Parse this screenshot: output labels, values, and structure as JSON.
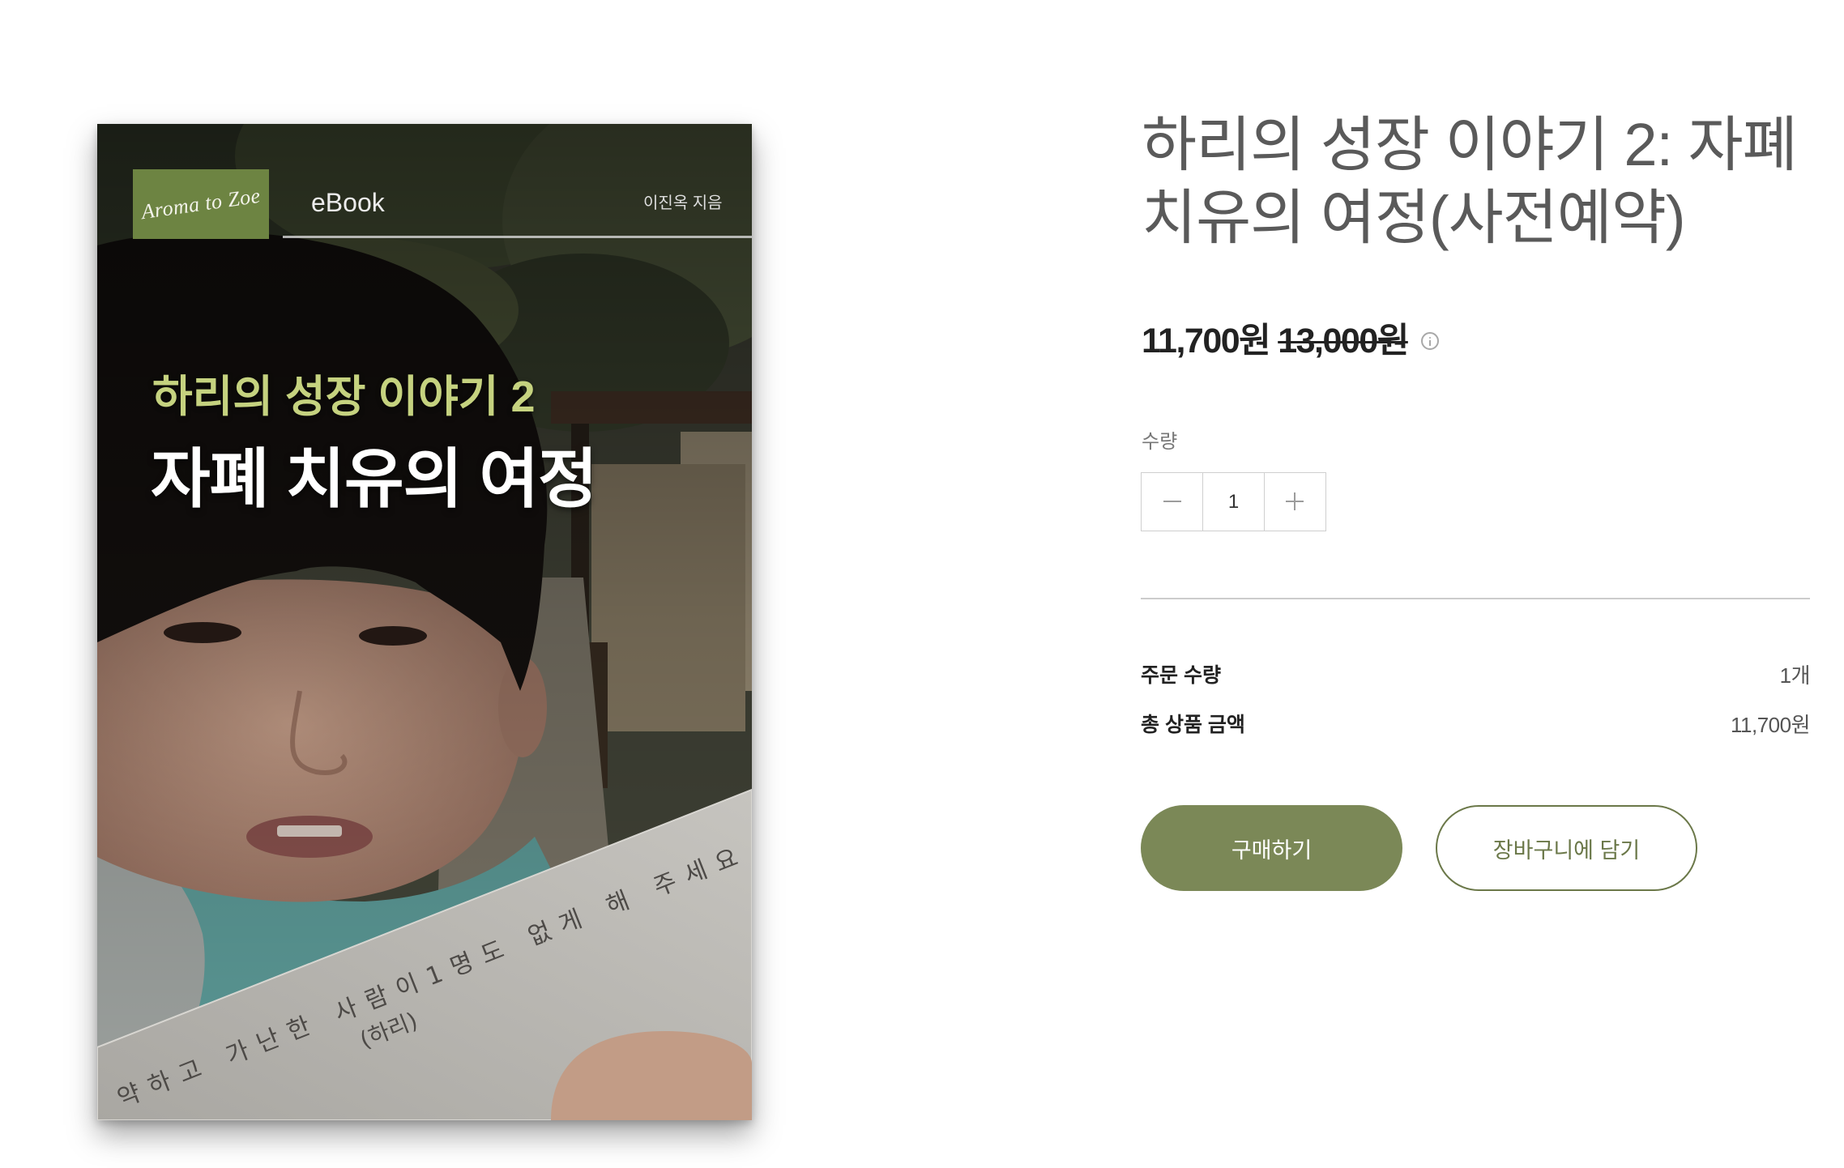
{
  "cover": {
    "logo_text": "Aroma to Zoe",
    "format_label": "eBook",
    "author": "이진옥 지음",
    "series_title": "하리의 성장 이야기 2",
    "main_title": "자폐 치유의 여정",
    "note_line1": "약하고 가난한 사람이1명도 없게 해 주세요",
    "note_line2": "(하리)"
  },
  "product": {
    "title": "하리의 성장 이야기 2: 자폐 치유의 여정(사전예약)",
    "sale_price": "11,700원",
    "original_price": "13,000원",
    "quantity_label": "수량",
    "quantity_value": "1"
  },
  "summary": {
    "order_quantity_label": "주문 수량",
    "order_quantity_value": "1개",
    "total_label": "총 상품 금액",
    "total_value": "11,700원"
  },
  "actions": {
    "buy_label": "구매하기",
    "cart_label": "장바구니에 담기"
  },
  "icons": {
    "price_info": "info-icon",
    "decrease": "minus-icon",
    "increase": "plus-icon"
  },
  "colors": {
    "accent": "#7b8857",
    "accent_outline": "#6b7849",
    "title_gray": "#5a5a5a",
    "logo_green": "#6d8442",
    "cover_series_title": "#c5d27f"
  }
}
